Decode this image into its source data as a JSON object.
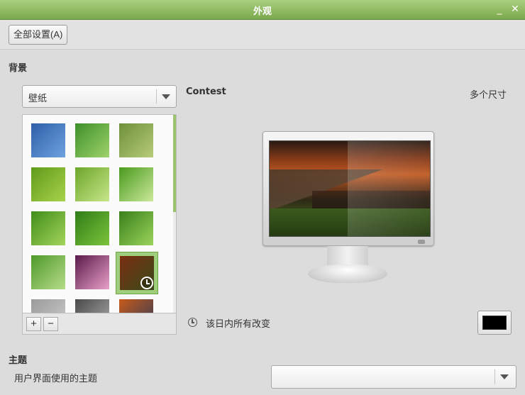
{
  "window": {
    "title": "外观"
  },
  "toolbar": {
    "all_settings_label": "全部设置(A)"
  },
  "background": {
    "section_title": "背景",
    "source_combo": {
      "selected": "壁纸"
    },
    "wallpaper_name": "Contest",
    "size_label": "多个尺寸",
    "change_label": "该日内所有改变",
    "color_swatch": "#000000",
    "add_label": "+",
    "remove_label": "−",
    "thumbnails": [
      {
        "icon": "wallpaper-blue-thumb",
        "colors": [
          "#2e5fa8",
          "#6ea2e0"
        ]
      },
      {
        "icon": "wallpaper-green-swirl-thumb",
        "colors": [
          "#3d8f2a",
          "#9fd36a"
        ]
      },
      {
        "icon": "wallpaper-olive-thumb",
        "colors": [
          "#6e8f3a",
          "#b7cc7a"
        ]
      },
      {
        "icon": "wallpaper-green-texture-thumb",
        "colors": [
          "#5e9b1a",
          "#a9d24a"
        ]
      },
      {
        "icon": "wallpaper-green-curve-thumb",
        "colors": [
          "#6ba62a",
          "#c8e68a"
        ]
      },
      {
        "icon": "wallpaper-green-rays-thumb",
        "colors": [
          "#4a9a1e",
          "#cbe99a"
        ]
      },
      {
        "icon": "wallpaper-green-bokeh-thumb",
        "colors": [
          "#3f8d1a",
          "#a4d45a"
        ]
      },
      {
        "icon": "wallpaper-leaf-thumb",
        "colors": [
          "#2f7d18",
          "#7cc43a"
        ]
      },
      {
        "icon": "wallpaper-dewdrop-thumb",
        "colors": [
          "#3a7f1a",
          "#9ad45a"
        ]
      },
      {
        "icon": "wallpaper-grass-thumb",
        "colors": [
          "#4e9a2a",
          "#b6dc8a"
        ]
      },
      {
        "icon": "wallpaper-pink-glow-thumb",
        "colors": [
          "#5a1a4a",
          "#e8a0c8"
        ]
      },
      {
        "icon": "wallpaper-contest-thumb",
        "colors": [
          "#7a2e12",
          "#3b4a1a"
        ],
        "selected": true
      },
      {
        "icon": "wallpaper-gray-thumb",
        "colors": [
          "#9a9a9a",
          "#cfcfcf"
        ]
      },
      {
        "icon": "wallpaper-stones-thumb",
        "colors": [
          "#4a4a4a",
          "#b0b0b0"
        ]
      },
      {
        "icon": "wallpaper-sunset-thumb",
        "colors": [
          "#c85a1a",
          "#2a3a5a"
        ]
      }
    ]
  },
  "theme": {
    "section_title": "主题",
    "label": "用户界面使用的主题",
    "combo": {
      "selected": ""
    }
  }
}
